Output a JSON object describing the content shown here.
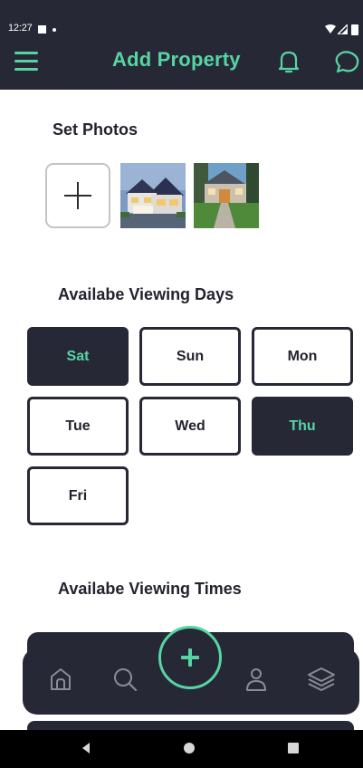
{
  "status_bar": {
    "time": "12:27"
  },
  "header": {
    "title": "Add Property",
    "menu_icon": "hamburger-menu-icon",
    "notification_icon": "bell-icon",
    "chat_icon": "chat-bubble-icon",
    "accent_color": "#56d5a3",
    "background_color": "#272836"
  },
  "photos": {
    "heading": "Set Photos",
    "add_icon": "plus-icon",
    "thumbnails": [
      "house-photo-twilight",
      "house-photo-daylight"
    ]
  },
  "viewing_days": {
    "heading": "Availabe Viewing Days",
    "days": [
      {
        "label": "Sat",
        "selected": true
      },
      {
        "label": "Sun",
        "selected": false
      },
      {
        "label": "Mon",
        "selected": false
      },
      {
        "label": "Tue",
        "selected": false
      },
      {
        "label": "Wed",
        "selected": false
      },
      {
        "label": "Thu",
        "selected": true
      },
      {
        "label": "Fri",
        "selected": false
      }
    ]
  },
  "viewing_times": {
    "heading": "Availabe Viewing Times"
  },
  "bottom_nav": {
    "items": [
      "home-icon",
      "search-icon",
      "add-fab-icon",
      "profile-icon",
      "layers-icon"
    ]
  },
  "system_nav": {
    "items": [
      "back-icon",
      "home-icon",
      "recents-icon"
    ]
  }
}
